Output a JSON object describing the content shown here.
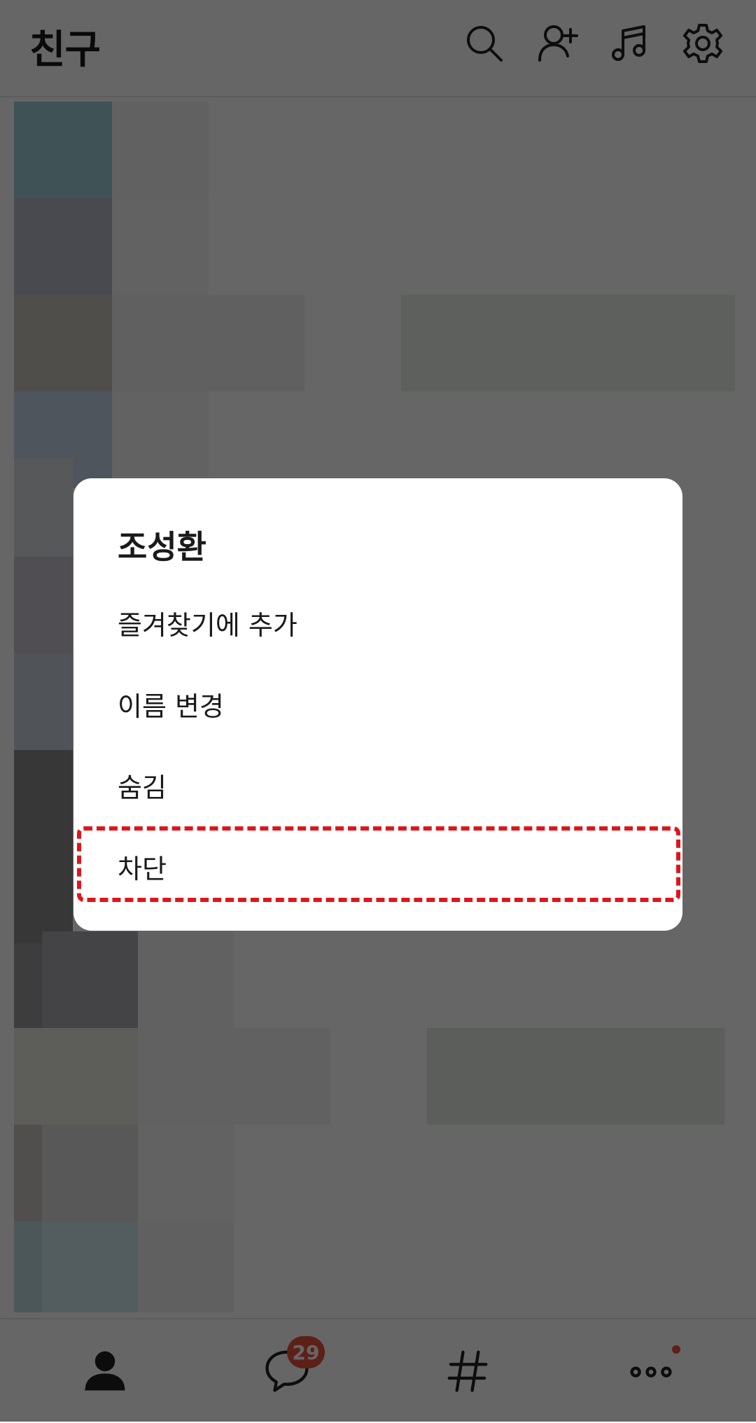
{
  "header": {
    "title": "친구",
    "icons": [
      "search-icon",
      "add-friend-icon",
      "music-icon",
      "settings-icon"
    ]
  },
  "dialog": {
    "friend_name": "조성환",
    "menu": [
      {
        "label": "즐겨찾기에 추가"
      },
      {
        "label": "이름 변경"
      },
      {
        "label": "숨김"
      },
      {
        "label": "차단"
      }
    ]
  },
  "bottom_nav": {
    "tabs": [
      "friends-icon",
      "chats-icon",
      "openchat-hashtag-icon",
      "more-icon"
    ],
    "chat_badge": "29"
  },
  "colors": {
    "badge": "#e8503a",
    "highlight": "#e0151b"
  }
}
